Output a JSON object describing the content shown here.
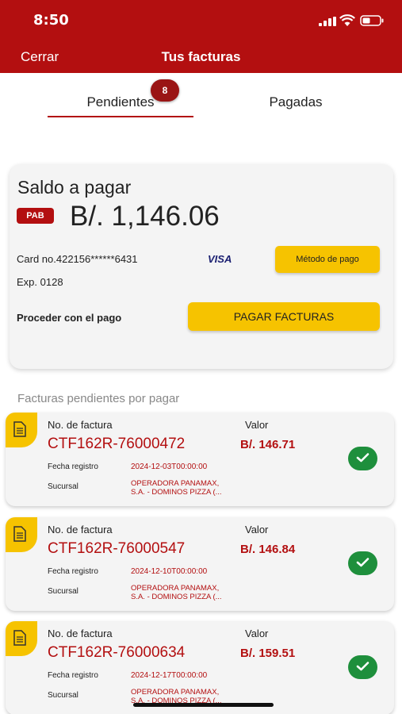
{
  "status_bar": {
    "time": "8:50"
  },
  "nav": {
    "close_label": "Cerrar",
    "title": "Tus facturas"
  },
  "tabs": {
    "pending_label": "Pendientes",
    "pending_count": "8",
    "paid_label": "Pagadas"
  },
  "summary": {
    "balance_label": "Saldo a pagar",
    "currency": "PAB",
    "balance_amount": "B/. 1,146.06",
    "card_number": "Card no.422156******6431",
    "card_brand": "VISA",
    "expiry": "Exp. 0128",
    "method_button": "Método de pago",
    "proceed_label": "Proceder con el pago",
    "pay_button": "PAGAR FACTURAS"
  },
  "list": {
    "section_title": "Facturas pendientes por pagar",
    "invoice_label": "No. de factura",
    "value_label": "Valor",
    "date_label": "Fecha registro",
    "branch_label": "Sucursal",
    "invoices": [
      {
        "number": "CTF162R-76000472",
        "amount": "B/. 146.71",
        "date": "2024-12-03T00:00:00",
        "branch_line1": "OPERADORA PANAMAX,",
        "branch_line2": "S.A. - DOMINOS PIZZA (..."
      },
      {
        "number": "CTF162R-76000547",
        "amount": "B/. 146.84",
        "date": "2024-12-10T00:00:00",
        "branch_line1": "OPERADORA PANAMAX,",
        "branch_line2": "S.A. - DOMINOS PIZZA (..."
      },
      {
        "number": "CTF162R-76000634",
        "amount": "B/. 159.51",
        "date": "2024-12-17T00:00:00",
        "branch_line1": "OPERADORA PANAMAX,",
        "branch_line2": "S.A. - DOMINOS PIZZA (..."
      }
    ]
  },
  "colors": {
    "brand_red": "#b30f10",
    "accent_yellow": "#f6c300",
    "success_green": "#1e8f3c"
  }
}
